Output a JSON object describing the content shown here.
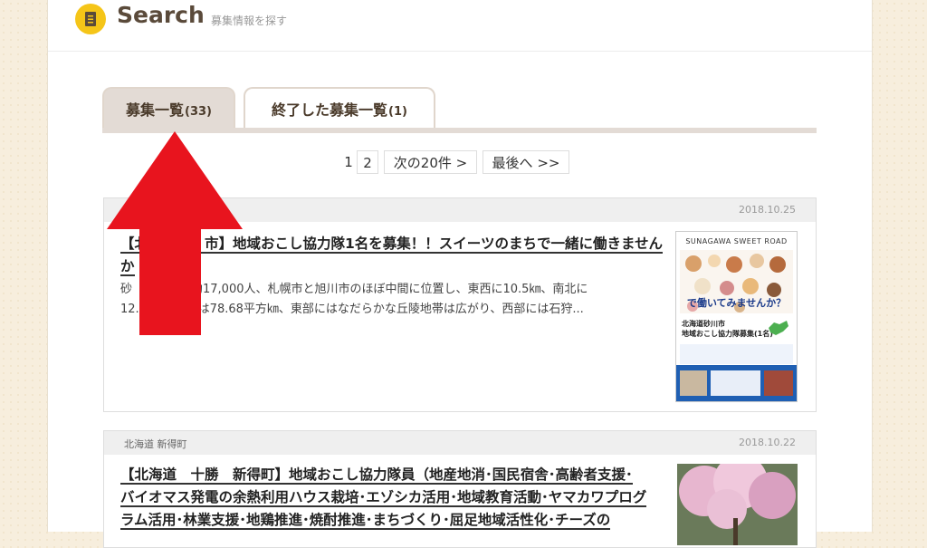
{
  "header": {
    "title": "Search",
    "subtitle": "募集情報を探す"
  },
  "tabs": [
    {
      "label": "募集一覧",
      "count": "(33)"
    },
    {
      "label": "終了した募集一覧",
      "count": "(1)"
    }
  ],
  "pagination": {
    "current": "1",
    "page2": "2",
    "next": "次の20件 >",
    "last": "最後へ >>"
  },
  "listings": [
    {
      "region": "",
      "date": "2018.10.25",
      "title_line1": "【北　　　　市】地域おこし協力隊1名を募集！！スイーツのまちで一緒に働きません",
      "title_line2": "か",
      "body_line1": "砂　　　　口約17,000人、札幌市と旭川市のほぼ中間に位置し、東西に10.5㎞、南北に",
      "body_line2": "12.　　　　積は78.68平方㎞、東部にはなだらかな丘陵地帯は広がり、西部には石狩...",
      "thumb": {
        "heading": "SUNAGAWA SWEET ROAD",
        "catch": "で働いてみませんか？",
        "caption1": "北海道砂川市",
        "caption2": "地域おこし協力隊募集(1名)"
      }
    },
    {
      "region": "北海道 新得町",
      "date": "2018.10.22",
      "title_line1": "【北海道　十勝　新得町】地域おこし協力隊員（地産地消･国民宿舎･高齢者支援･",
      "title_line2": "バイオマス発電の余熱利用ハウス栽培･エゾシカ活用･地域教育活動･ヤマカワプログ",
      "title_line3": "ラム活用･林業支援･地鶏推進･焼酎推進･まちづくり･屈足地域活性化･チーズの"
    }
  ],
  "colors": {
    "background": "#f7eedd",
    "tab_active": "#e3dbd5",
    "icon_yellow": "#f5c518",
    "arrow_red": "#e8141e"
  }
}
